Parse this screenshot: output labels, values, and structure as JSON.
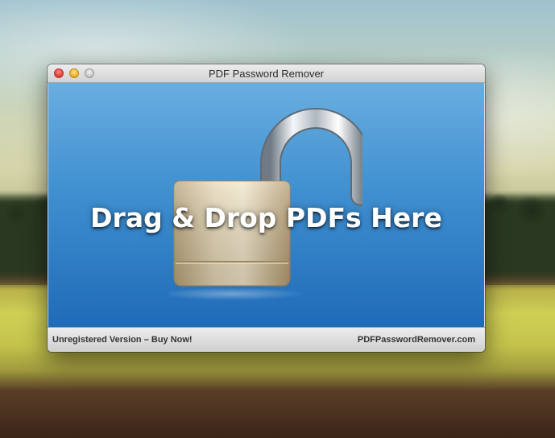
{
  "window": {
    "title": "PDF Password Remover"
  },
  "drop_area": {
    "label": "Drag & Drop PDFs Here",
    "icon": "open-padlock-icon"
  },
  "status_bar": {
    "left_text": "Unregistered Version – Buy Now!",
    "right_text": "PDFPasswordRemover.com"
  },
  "colors": {
    "drop_area_top": "#69aee0",
    "drop_area_bottom": "#1f6ab7"
  }
}
